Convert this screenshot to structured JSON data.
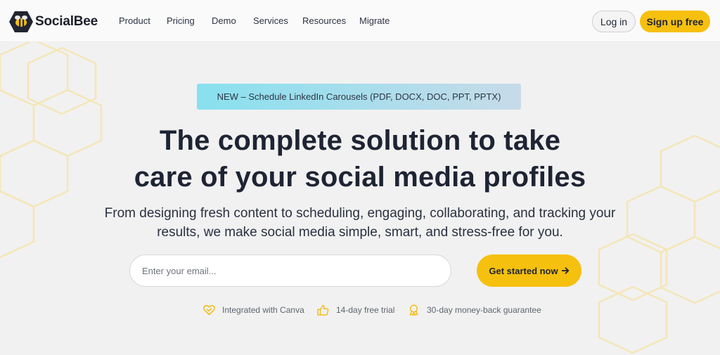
{
  "brand": {
    "name": "SocialBee",
    "logo_icon": "bee-hexagon-icon"
  },
  "colors": {
    "accent": "#f6c00e",
    "dark": "#1e2433",
    "announce_start": "#88e0ef",
    "announce_end": "#c7dbe9"
  },
  "nav": {
    "items": [
      {
        "label": "Product"
      },
      {
        "label": "Pricing"
      },
      {
        "label": "Demo"
      },
      {
        "label": "Services"
      },
      {
        "label": "Resources"
      },
      {
        "label": "Migrate"
      }
    ],
    "login_label": "Log in",
    "signup_label": "Sign up free"
  },
  "hero": {
    "announcement": "NEW – Schedule LinkedIn Carousels (PDF, DOCX, DOC, PPT, PPTX)",
    "headline_line1": "The complete solution to take",
    "headline_line2": "care of your social media profiles",
    "subhead_line1": "From designing fresh content to scheduling, engaging, collaborating, and tracking your",
    "subhead_line2": "results, we make social media simple, smart, and stress-free for you.",
    "email_placeholder": "Enter your email...",
    "cta_label": "Get started now",
    "cta_icon": "arrow-right-icon"
  },
  "features": [
    {
      "icon": "heart-check-icon",
      "label": "Integrated with Canva"
    },
    {
      "icon": "thumbs-up-icon",
      "label": "14-day free trial"
    },
    {
      "icon": "award-badge-icon",
      "label": "30-day money-back guarantee"
    }
  ]
}
